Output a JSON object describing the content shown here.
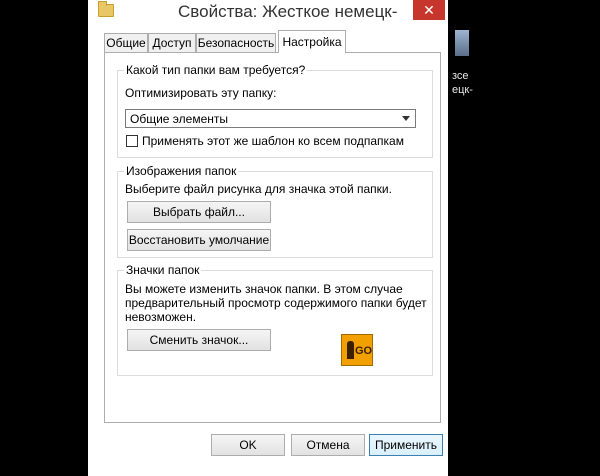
{
  "desktop": {
    "text1": "зсе",
    "text2": "ецк-"
  },
  "window": {
    "title": "Свойства: Жесткое немецк-",
    "close_glyph": "✕"
  },
  "tabs": [
    {
      "label": "Общие"
    },
    {
      "label": "Доступ"
    },
    {
      "label": "Безопасность"
    },
    {
      "label": "Настройка"
    }
  ],
  "folder_type": {
    "title": "Какой тип папки вам требуется?",
    "optimize_label": "Оптимизировать эту папку:",
    "selected": "Общие элементы",
    "checkbox_label": "Применять этот же шаблон ко всем подпапкам",
    "checked": false
  },
  "folder_images": {
    "title": "Изображения папок",
    "desc": "Выберите файл рисунка для значка этой папки.",
    "choose_button": "Выбрать файл...",
    "restore_button": "Восстановить умолчание"
  },
  "folder_icons": {
    "title": "Значки папок",
    "desc_line1": "Вы можете изменить значок папки. В этом случае",
    "desc_line2": "предварительный просмотр содержимого папки будет",
    "desc_line3": "невозможен.",
    "change_button": "Сменить значок...",
    "icon_text": "GO"
  },
  "footer": {
    "ok": "OK",
    "cancel": "Отмена",
    "apply": "Применить"
  }
}
